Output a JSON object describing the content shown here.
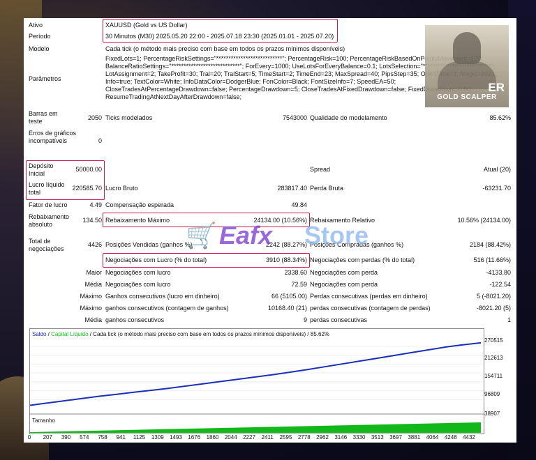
{
  "report": {
    "ativo": {
      "label": "Ativo",
      "value": "XAUUSD (Gold vs US Dollar)"
    },
    "periodo": {
      "label": "Período",
      "value": "30 Minutos (M30) 2025.05.20 22:00 - 2025.07.18 23:30 (2025.01.01 - 2025.07.20)"
    },
    "modelo": {
      "label": "Modelo",
      "value": "Cada tick (o método mais preciso com base em todos os prazos mínimos disponíveis)"
    },
    "parametros": {
      "label": "Parâmetros",
      "value": "FixedLots=1; PercentageRiskSettings=\"***************************\"; PercentageRisk=100; PercentageRiskBasedOnPointsMovement=100; BalanceRatioSettings=\"****************************\"; ForEvery=1000; UseLotsForEveryBalance=0.1; LotsSelection=\"****************************\"; LotAssignment=2; TakeProfit=30; Tral=20; TralStart=5; TimeStart=2; TimeEnd=23; MaxSpread=40; PipsStep=35; OpenTime=1; Magic=2021; Info=true; TextColor=White; InfoDataColor=DodgerBlue; FonColor=Black; FontSizeInfo=7; SpeedEA=50; CloseTradesAtPercentageDrawdown=false; PercentageDrawdown=5; CloseTradesAtFixedDrawdown=false; FixedDrawdown=1000; ResumeTradingAtNextDayAfterDrawdown=false;"
    },
    "barras": {
      "label": "Barras em teste",
      "value": "2050"
    },
    "ticks": {
      "label": "Ticks modelados",
      "value": "7543000"
    },
    "qualidade": {
      "label": "Qualidade do modelamento",
      "value": "85.62%"
    },
    "erros": {
      "label": "Erros de gráficos incompatíveis",
      "value": "0"
    },
    "deposito": {
      "label": "Depósito Inicial",
      "value": "50000.00"
    },
    "spread": {
      "label": "Spread",
      "value": "Atual (20)"
    },
    "lucro_liquido": {
      "label": "Lucro líquido total",
      "value": "220585.70"
    },
    "lucro_bruto": {
      "label": "Lucro Bruto",
      "value": "283817.40"
    },
    "perda_bruta": {
      "label": "Perda Bruta",
      "value": "-63231.70"
    },
    "fator_lucro": {
      "label": "Fator de lucro",
      "value": "4.49"
    },
    "compensacao": {
      "label": "Compensação esperada",
      "value": "49.84"
    },
    "rebaix_abs": {
      "label": "Rebaixamento absoluto",
      "value": "134.50"
    },
    "rebaix_max": {
      "label": "Rebaixamento Máximo",
      "value": "24134.00 (10.56%)"
    },
    "rebaix_rel": {
      "label": "Rebaixamento Relativo",
      "value": "10.56% (24134.00)"
    },
    "total_neg": {
      "label": "Total de negociações",
      "value": "4426"
    },
    "pos_vendidas": {
      "label": "Posições Vendidas (ganhos %)",
      "value": "2242 (88.27%)"
    },
    "pos_compradas": {
      "label": "Posições Compradas (ganhos %)",
      "value": "2184 (88.42%)"
    },
    "neg_lucro_total": {
      "label": "Negociações com Lucro (% do total)",
      "value": "3910 (88.34%)"
    },
    "neg_perda_total": {
      "label": "Negociações com perdas (% do total)",
      "value": "516 (11.66%)"
    },
    "maior": {
      "prefix": "Maior",
      "lucro_label": "Negociações com lucro",
      "lucro_value": "2338.60",
      "perda_label": "Negociações com perda",
      "perda_value": "-4133.80"
    },
    "media": {
      "prefix": "Média",
      "lucro_label": "Negociações com lucro",
      "lucro_value": "72.59",
      "perda_label": "Negociações com perda",
      "perda_value": "-122.54"
    },
    "maximo1": {
      "prefix": "Máximo",
      "lucro_label": "Ganhos consecutivos (lucro em dinheiro)",
      "lucro_value": "66 (5105.00)",
      "perda_label": "Perdas consecutivas (perdas em dinheiro)",
      "perda_value": "5 (-8021.20)"
    },
    "maximo2": {
      "prefix": "Máximo",
      "lucro_label": "ganhos consecutivos (contagem de ganhos)",
      "lucro_value": "10168.40 (21)",
      "perda_label": "perdas consecutivas (contagem de perdas)",
      "perda_value": "-8021.20 (5)"
    },
    "media2": {
      "prefix": "Média",
      "lucro_label": "ganhos consecutivos",
      "lucro_value": "9",
      "perda_label": "perdas consecutivas",
      "perda_value": "1"
    }
  },
  "logo": {
    "big": "ER",
    "name": "GOLD SCALPER"
  },
  "watermark": {
    "brand1": "Eafx",
    "brand2": "Store",
    "cart_icon": "cart-icon"
  },
  "chart_header": {
    "saldo": "Saldo",
    "sep": " / ",
    "capital": "Capital Líquido",
    "rest": " / Cada tick (o método mais preciso com base em todos os prazos mínimos disponíveis) / 85.62%"
  },
  "chart_volume_label": "Tamanho",
  "colors": {
    "highlight": "#d01848",
    "balance": "#1a2fb8",
    "volume": "#12b81a"
  },
  "chart_data": {
    "type": "line",
    "series": [
      {
        "name": "Saldo",
        "values": [
          50000,
          58000,
          66000,
          74000,
          82000,
          89000,
          96000,
          103000,
          110000,
          118000,
          126000,
          134000,
          142000,
          150000,
          158000,
          167000,
          176000,
          186000,
          196000,
          206000,
          216000,
          226000,
          236000,
          246000,
          256000,
          264000,
          270585
        ]
      }
    ],
    "x_ticks": [
      "0",
      "207",
      "390",
      "574",
      "758",
      "941",
      "1125",
      "1309",
      "1493",
      "1676",
      "1860",
      "2044",
      "2227",
      "2411",
      "2595",
      "2778",
      "2962",
      "3146",
      "3330",
      "3513",
      "3697",
      "3881",
      "4064",
      "4248",
      "4432"
    ],
    "y_ticks": [
      "270515",
      "212613",
      "154711",
      "96809",
      "38907"
    ],
    "xlim": [
      0,
      4426
    ],
    "ylim": [
      38907,
      290000
    ]
  }
}
